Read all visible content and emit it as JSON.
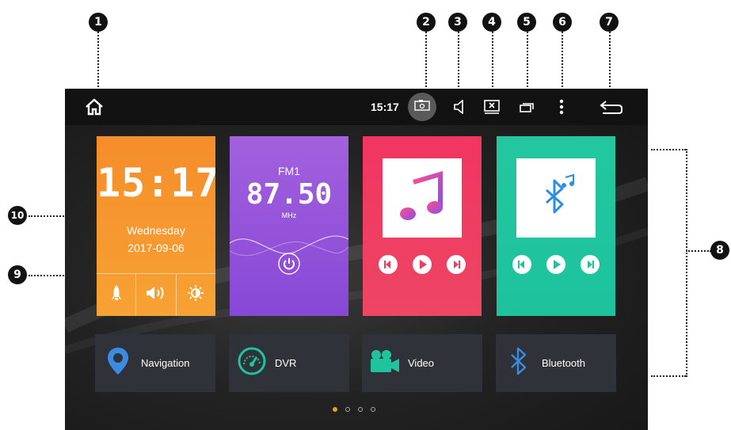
{
  "markers": [
    "1",
    "2",
    "3",
    "4",
    "5",
    "6",
    "7",
    "8",
    "9",
    "10"
  ],
  "status_bar": {
    "time": "15:17",
    "icons": [
      "home-icon",
      "screenshot-icon",
      "volume-icon",
      "close-app-icon",
      "recent-apps-icon",
      "more-icon",
      "back-icon"
    ]
  },
  "clock_widget": {
    "time": "15:17",
    "day": "Wednesday",
    "date": "2017-09-06",
    "buttons": [
      "rocket-icon",
      "volume-icon",
      "brightness-icon"
    ]
  },
  "radio_widget": {
    "band": "FM1",
    "frequency": "87.50",
    "unit": "MHz"
  },
  "app_shortcuts": [
    {
      "label": "Navigation",
      "icon": "map-pin-icon"
    },
    {
      "label": "DVR",
      "icon": "speedometer-icon"
    },
    {
      "label": "Video",
      "icon": "video-camera-icon"
    },
    {
      "label": "Bluetooth",
      "icon": "bluetooth-icon"
    }
  ],
  "pager": {
    "total": 4,
    "active": 0
  },
  "colors": {
    "clock_tile": "#f7982f",
    "radio_tile": "#9556d9",
    "music_tile": "#f03d62",
    "bluetooth_tile": "#20c49e",
    "pager_active": "#f39a2c"
  }
}
